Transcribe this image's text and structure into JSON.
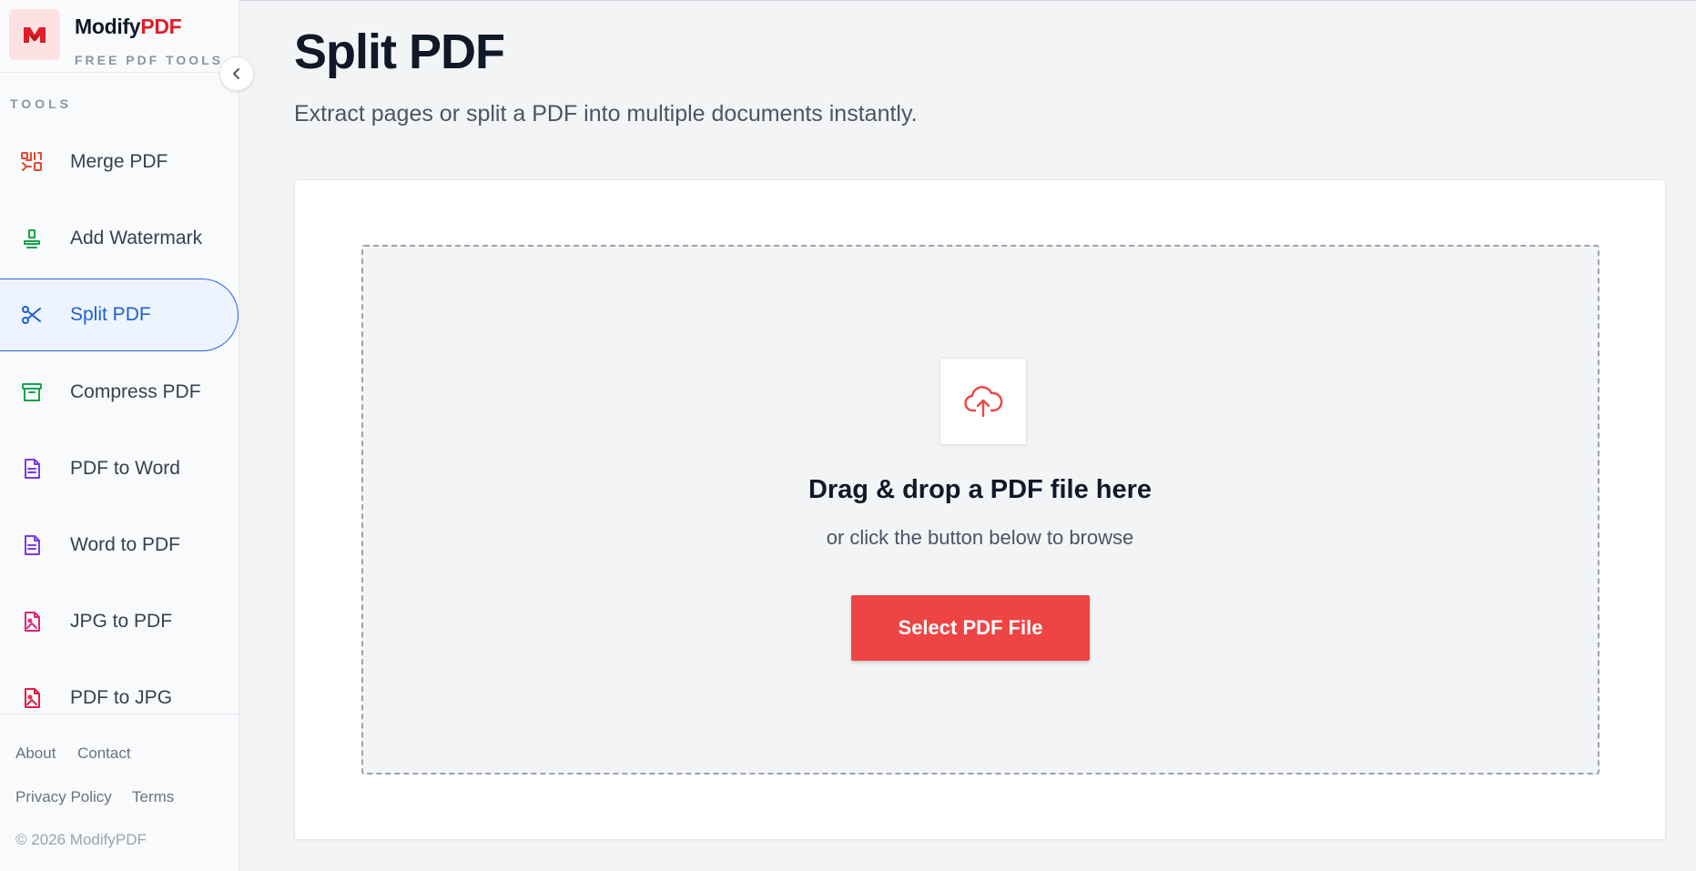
{
  "brand": {
    "name_primary": "Modify",
    "name_accent": "PDF",
    "tagline": "FREE PDF TOOLS"
  },
  "sidebar": {
    "section_label": "TOOLS",
    "items": [
      {
        "label": "Merge PDF",
        "icon": "merge-icon",
        "color": "#e8462e"
      },
      {
        "label": "Add Watermark",
        "icon": "stamp-icon",
        "color": "#16a34a"
      },
      {
        "label": "Split PDF",
        "icon": "scissors-icon",
        "color": "#1d5fd6",
        "active": true
      },
      {
        "label": "Compress PDF",
        "icon": "archive-icon",
        "color": "#16a34a"
      },
      {
        "label": "PDF to Word",
        "icon": "document-icon",
        "color": "#7c3aed"
      },
      {
        "label": "Word to PDF",
        "icon": "document-icon",
        "color": "#7c3aed"
      },
      {
        "label": "JPG to PDF",
        "icon": "image-file-icon",
        "color": "#db2777"
      },
      {
        "label": "PDF to JPG",
        "icon": "image-file-icon",
        "color": "#e11d48"
      }
    ],
    "footer": {
      "about": "About",
      "contact": "Contact",
      "privacy": "Privacy Policy",
      "terms": "Terms",
      "copyright": "© 2026 ModifyPDF"
    }
  },
  "main": {
    "title": "Split PDF",
    "subtitle": "Extract pages or split a PDF into multiple documents instantly.",
    "dropzone": {
      "title": "Drag & drop a PDF file here",
      "subtitle": "or click the button below to browse",
      "button_label": "Select PDF File",
      "icon": "cloud-upload-icon"
    }
  },
  "colors": {
    "accent": "#ef4444",
    "brand_red": "#e11d2a",
    "active_blue": "#2563eb"
  }
}
